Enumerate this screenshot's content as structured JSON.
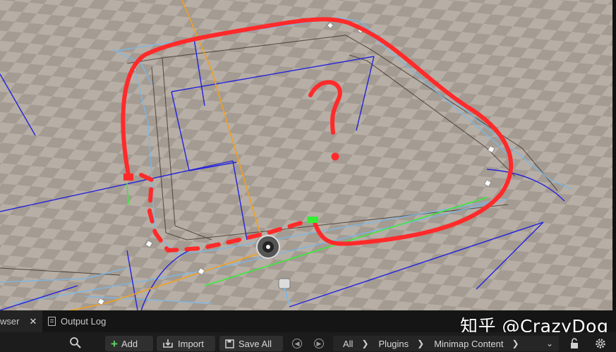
{
  "viewport": {
    "annotation_text": "?"
  },
  "tabs": [
    {
      "label": "wser",
      "close": "✕"
    },
    {
      "label": "Output Log"
    }
  ],
  "watermark": "知乎 @CrazyDog",
  "toolbar": {
    "add_label": "Add",
    "import_label": "Import",
    "save_all_label": "Save All"
  },
  "breadcrumb": [
    "All",
    "Plugins",
    "Minimap Content"
  ],
  "colors": {
    "spline_orange": "#f0a020",
    "volume_blue": "#2222dd",
    "nav_light_blue": "#7ab8e8",
    "sketch_red": "#ff2a2a",
    "path_green": "#33ee33",
    "add_green": "#5fd35f"
  }
}
